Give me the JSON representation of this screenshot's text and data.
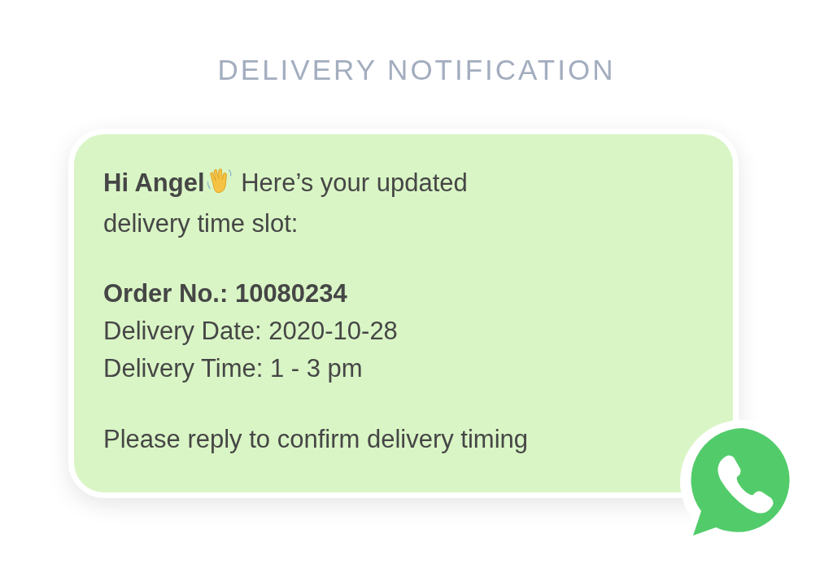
{
  "title": "DELIVERY NOTIFICATION",
  "message": {
    "greeting_name": "Hi Angel",
    "greeting_text": [
      "Here’s your updated",
      "delivery time slot:"
    ],
    "details": [
      {
        "text": "Order No.: 10080234",
        "bold": true
      },
      {
        "text": "Delivery Date: 2020-10-28",
        "bold": false
      },
      {
        "text": "Delivery Time: 1 - 3 pm",
        "bold": false
      }
    ],
    "closing": "Please reply to confirm delivery timing"
  }
}
